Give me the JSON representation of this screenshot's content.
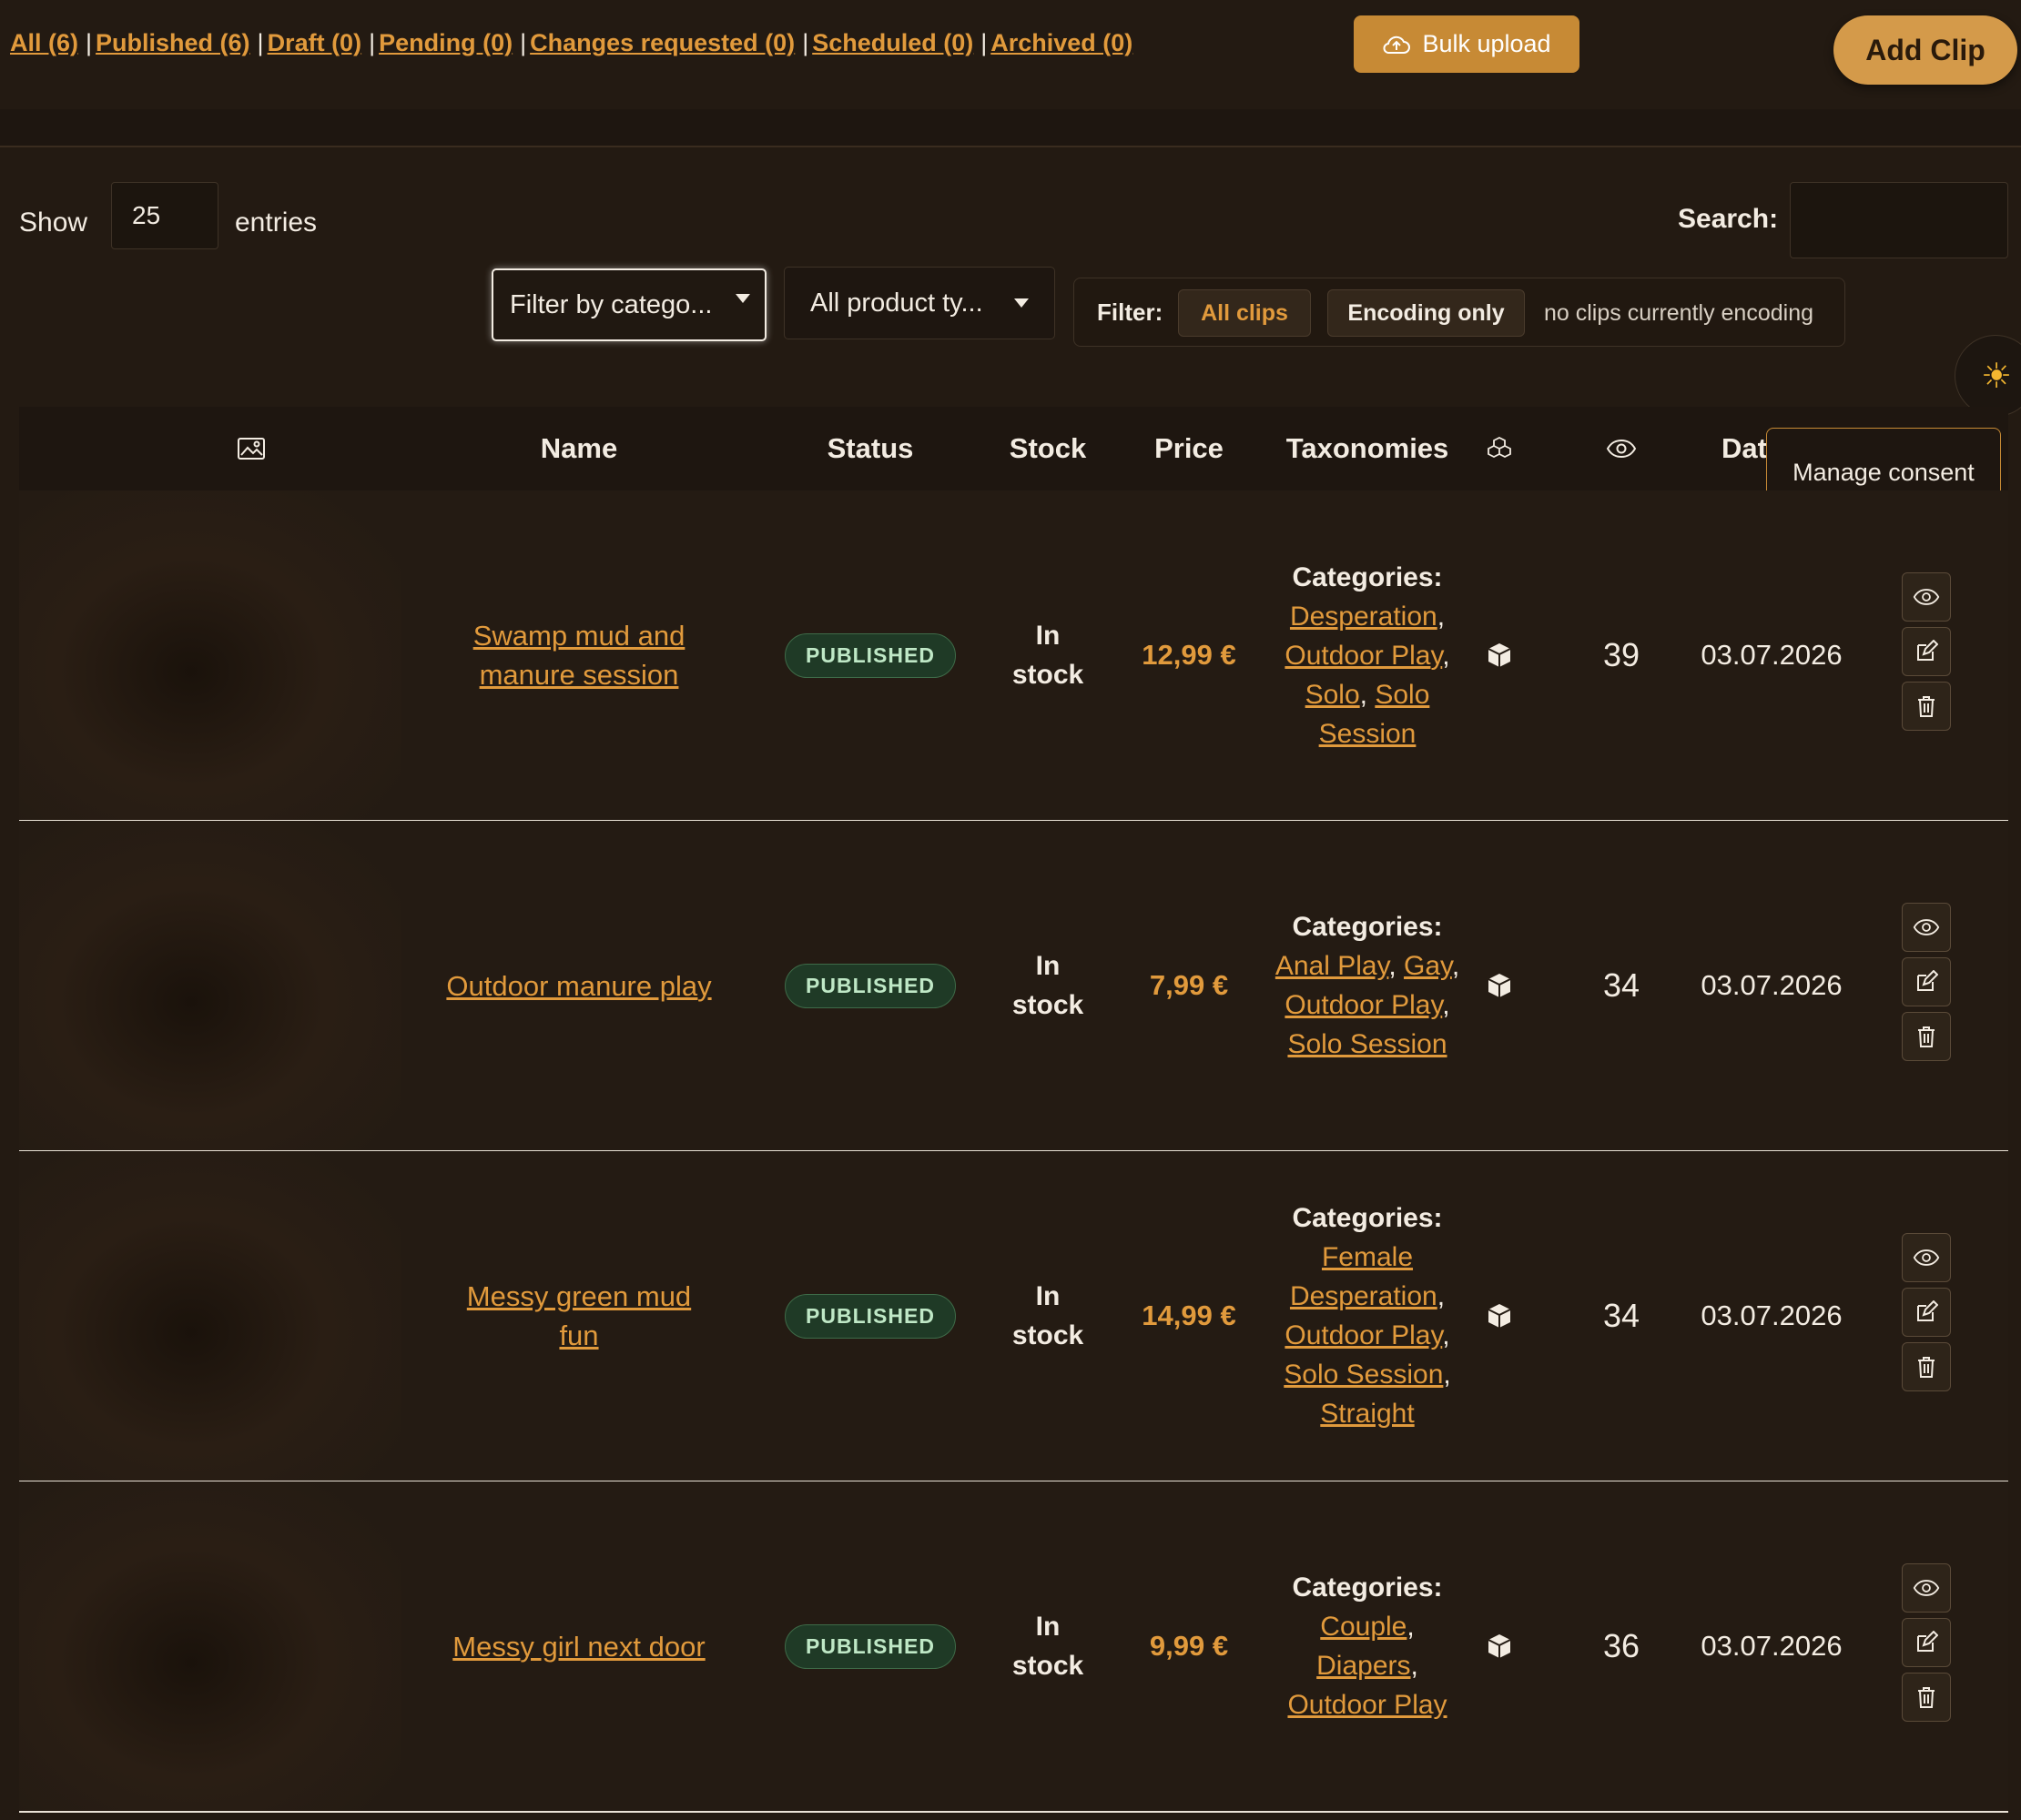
{
  "tabs": [
    {
      "label": "All (6)"
    },
    {
      "label": "Published (6)"
    },
    {
      "label": "Draft (0)"
    },
    {
      "label": "Pending (0)"
    },
    {
      "label": "Changes requested (0)"
    },
    {
      "label": "Scheduled (0)"
    },
    {
      "label": "Archived (0)"
    }
  ],
  "actions": {
    "bulk_upload": "Bulk upload",
    "add_clip": "Add Clip"
  },
  "controls": {
    "show_label": "Show",
    "page_length": "25",
    "entries_label": "entries",
    "search_label": "Search:",
    "search_value": "",
    "category_filter": "Filter by catego...",
    "product_type_filter": "All product ty...",
    "filter_label": "Filter:",
    "filter_all": "All clips",
    "filter_encoding": "Encoding only",
    "encoding_note": "no clips currently encoding"
  },
  "tooltip": "Manage consent",
  "table": {
    "headers": {
      "name": "Name",
      "status": "Status",
      "stock": "Stock",
      "price": "Price",
      "taxonomies": "Taxonomies",
      "date": "Dat"
    },
    "categories_label": "Categories:",
    "rows": [
      {
        "name_line1": "Swamp mud and",
        "name_line2": "manure session",
        "status": "PUBLISHED",
        "stock_line1": "In",
        "stock_line2": "stock",
        "price": "12,99 €",
        "categories": [
          "Desperation",
          "Outdoor Play",
          "Solo",
          "Solo Session"
        ],
        "views": "39",
        "date": "03.07.2026"
      },
      {
        "name_line1": "Outdoor manure play",
        "name_line2": "",
        "status": "PUBLISHED",
        "stock_line1": "In",
        "stock_line2": "stock",
        "price": "7,99 €",
        "categories": [
          "Anal Play",
          "Gay",
          "Outdoor Play",
          "Solo Session"
        ],
        "views": "34",
        "date": "03.07.2026"
      },
      {
        "name_line1": "Messy green mud",
        "name_line2": "fun",
        "status": "PUBLISHED",
        "stock_line1": "In",
        "stock_line2": "stock",
        "price": "14,99 €",
        "categories": [
          "Female Desperation",
          "Outdoor Play",
          "Solo Session",
          "Straight"
        ],
        "views": "34",
        "date": "03.07.2026"
      },
      {
        "name_line1": "Messy girl next door",
        "name_line2": "",
        "status": "PUBLISHED",
        "stock_line1": "In",
        "stock_line2": "stock",
        "price": "9,99 €",
        "categories": [
          "Couple",
          "Diapers",
          "Outdoor Play"
        ],
        "views": "36",
        "date": "03.07.2026"
      }
    ]
  },
  "icons": {
    "upload": "cloud-upload-icon",
    "theme": "sun-icon",
    "image": "image-icon",
    "boxes": "boxes-icon",
    "views": "eye-icon",
    "row_box": "box-icon",
    "view": "eye-icon",
    "edit": "edit-icon",
    "delete": "trash-icon"
  },
  "colors": {
    "accent": "#e19a3c",
    "background": "#231a12",
    "published_badge": "#1f3a26"
  }
}
